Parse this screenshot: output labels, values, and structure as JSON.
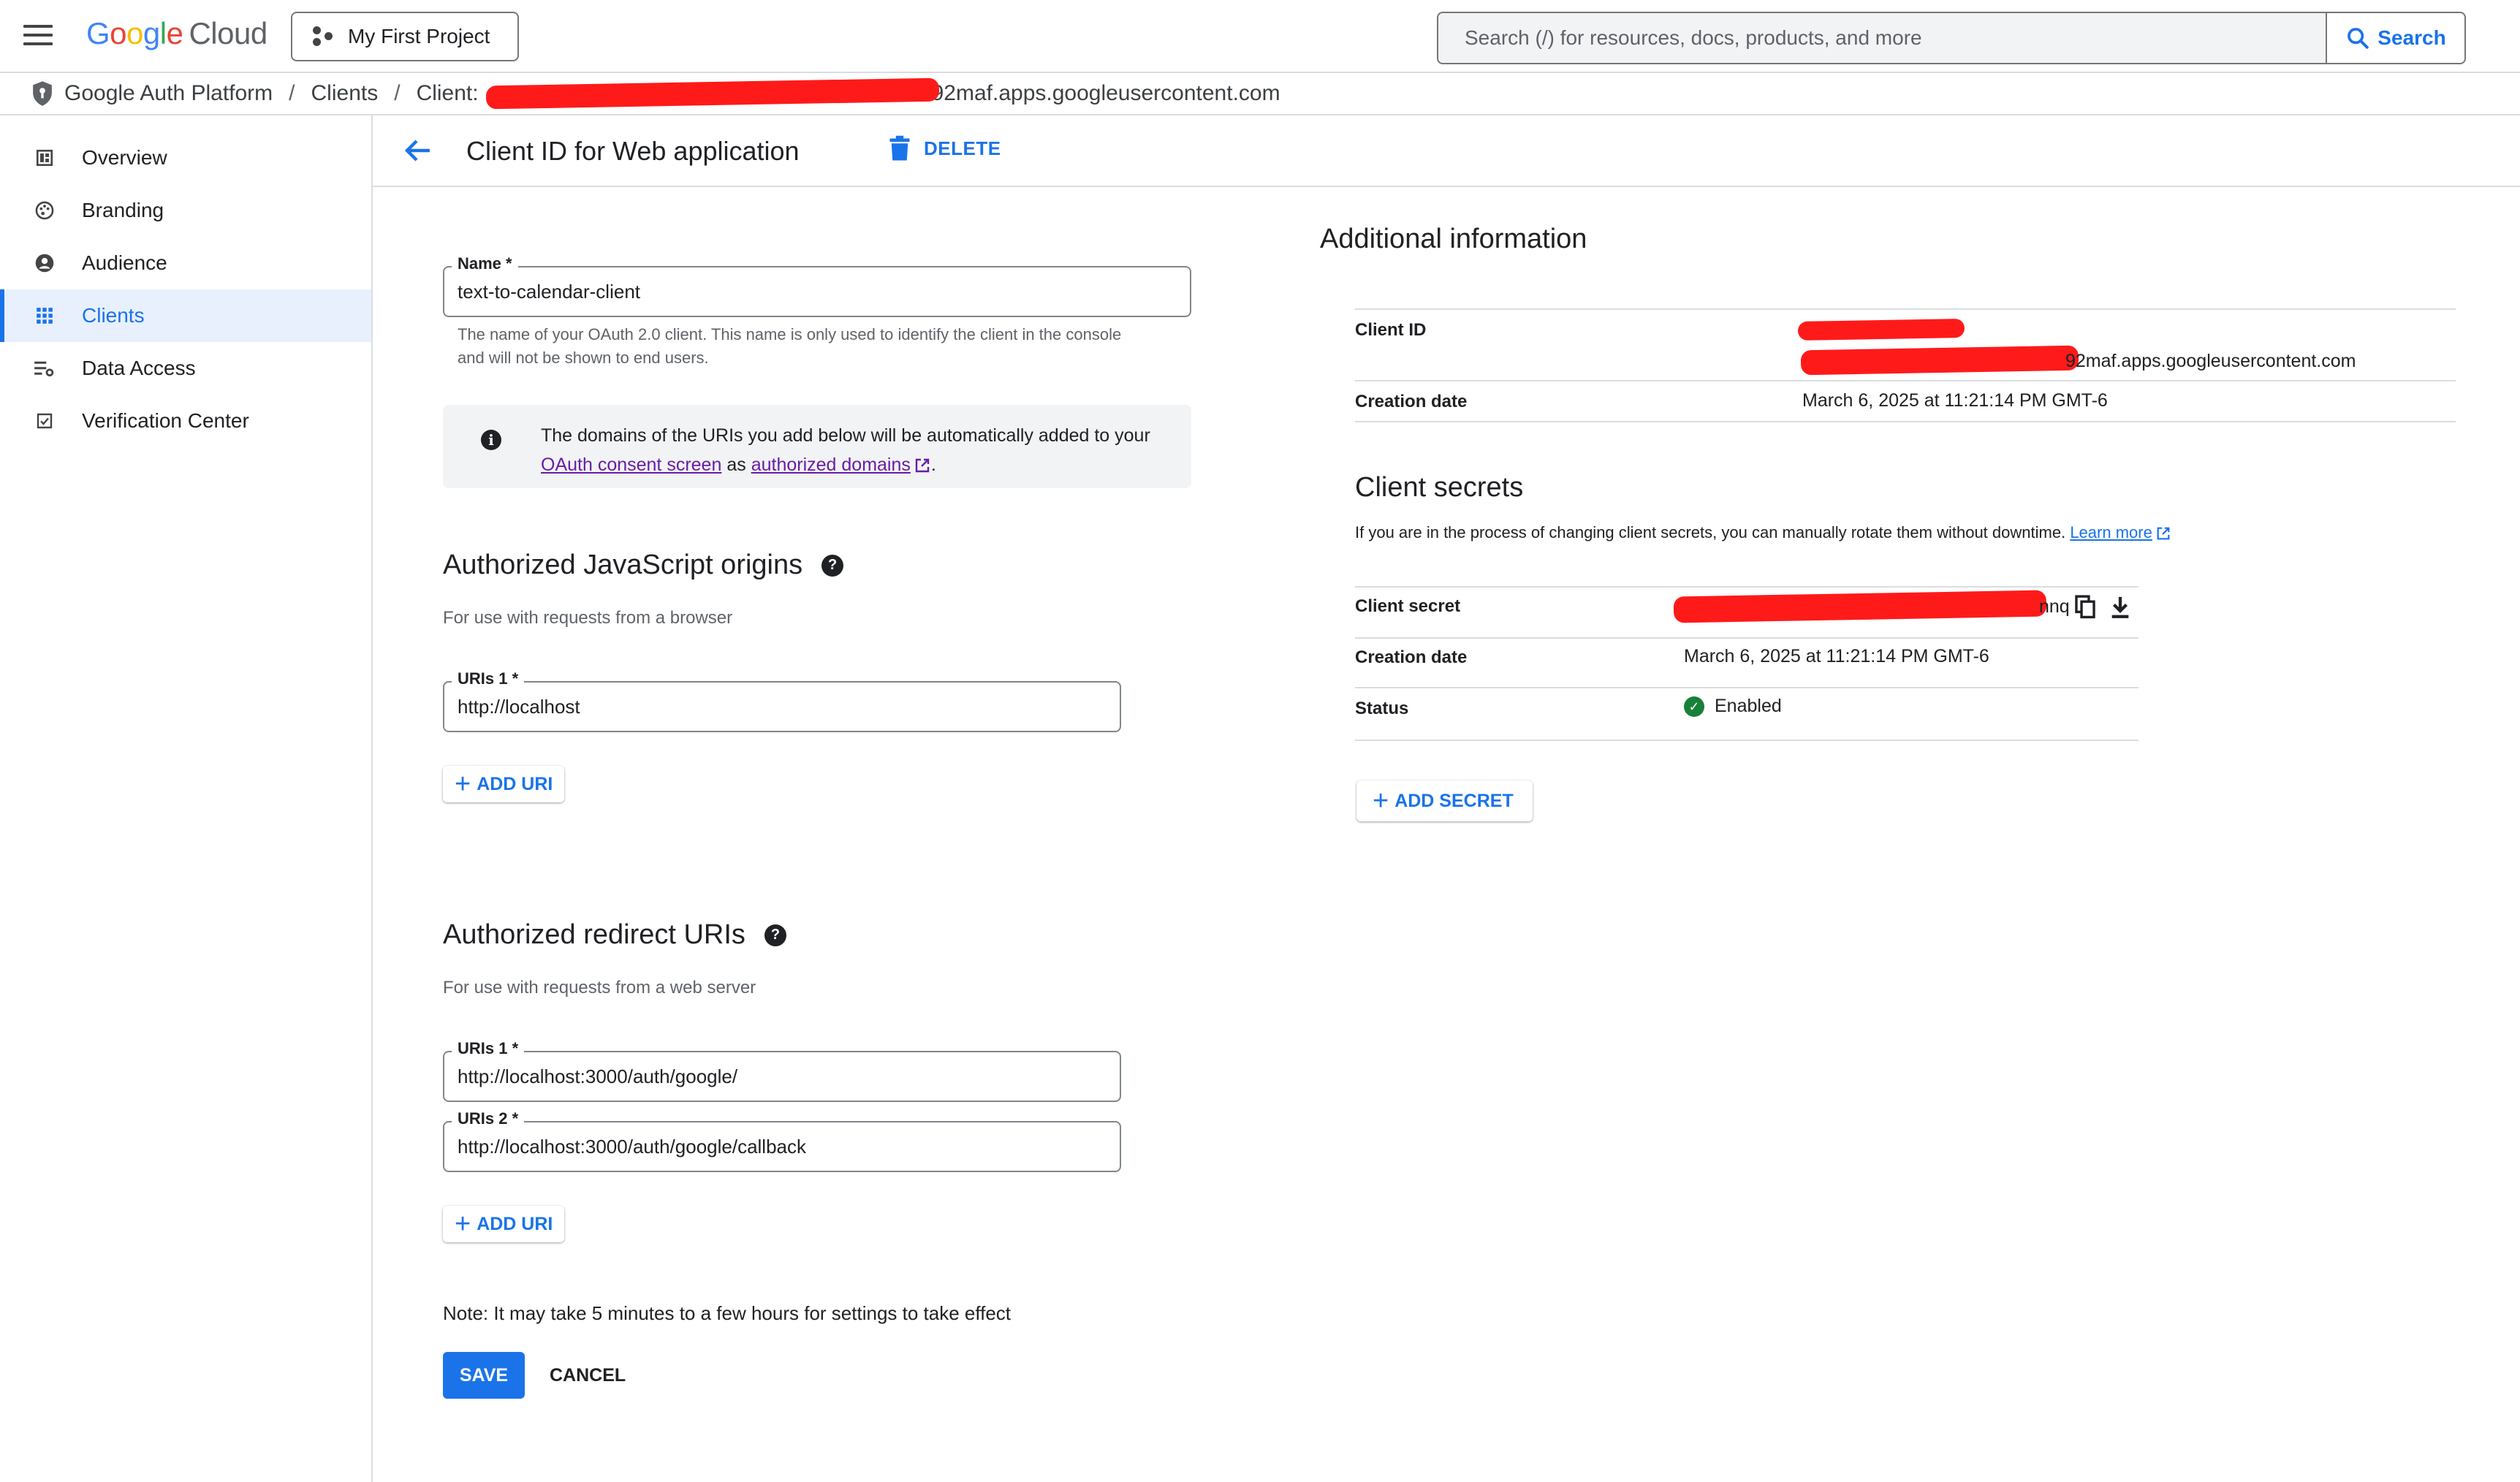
{
  "topbar": {
    "logo_google": "Google",
    "logo_cloud": "Cloud",
    "project_name": "My First Project",
    "search_placeholder": "Search (/) for resources, docs, products, and more",
    "search_button": "Search"
  },
  "breadcrumb": {
    "items": [
      "Google Auth Platform",
      "Clients",
      "Client:"
    ],
    "client_suffix": "92maf.apps.googleusercontent.com"
  },
  "sidebar": {
    "items": [
      {
        "label": "Overview",
        "icon": "dashboard-icon"
      },
      {
        "label": "Branding",
        "icon": "palette-icon"
      },
      {
        "label": "Audience",
        "icon": "account-circle-icon"
      },
      {
        "label": "Clients",
        "icon": "apps-grid-icon",
        "active": true
      },
      {
        "label": "Data Access",
        "icon": "data-access-icon"
      },
      {
        "label": "Verification Center",
        "icon": "checklist-icon"
      }
    ]
  },
  "header": {
    "title": "Client ID for Web application",
    "delete_label": "DELETE"
  },
  "form": {
    "name_label": "Name *",
    "name_value": "text-to-calendar-client",
    "name_helper": "The name of your OAuth 2.0 client. This name is only used to identify the client in the console and will not be shown to end users.",
    "info_prefix": "The domains of the URIs you add below will be automatically added to your",
    "info_link1": "OAuth consent screen",
    "info_mid": "as",
    "info_link2": "authorized domains",
    "info_suffix": ".",
    "js_origins_title": "Authorized JavaScript origins",
    "js_origins_sub": "For use with requests from a browser",
    "js_uri1_label": "URIs 1 *",
    "js_uri1_value": "http://localhost",
    "add_uri_label": "ADD URI",
    "redirect_title": "Authorized redirect URIs",
    "redirect_sub": "For use with requests from a web server",
    "redirect_uri1_label": "URIs 1 *",
    "redirect_uri1_value": "http://localhost:3000/auth/google/",
    "redirect_uri2_label": "URIs 2 *",
    "redirect_uri2_value": "http://localhost:3000/auth/google/callback",
    "note": "Note: It may take 5 minutes to a few hours for settings to take effect",
    "save_label": "SAVE",
    "cancel_label": "CANCEL"
  },
  "additional_info": {
    "title": "Additional information",
    "client_id_label": "Client ID",
    "client_id_suffix": "92maf.apps.googleusercontent.com",
    "creation_date_label": "Creation date",
    "creation_date_value": "March 6, 2025 at 11:21:14 PM GMT-6"
  },
  "client_secrets": {
    "title": "Client secrets",
    "description": "If you are in the process of changing client secrets, you can manually rotate them without downtime.",
    "learn_more": "Learn more",
    "secret_label": "Client secret",
    "secret_suffix": "nnq",
    "creation_date_label": "Creation date",
    "creation_date_value": "March 6, 2025 at 11:21:14 PM GMT-6",
    "status_label": "Status",
    "status_value": "Enabled",
    "add_secret_label": "ADD SECRET"
  },
  "colors": {
    "accent": "#1a73e8",
    "link_visited": "#681da8",
    "status_enabled": "#188038",
    "redaction": "#ff1a1a"
  }
}
